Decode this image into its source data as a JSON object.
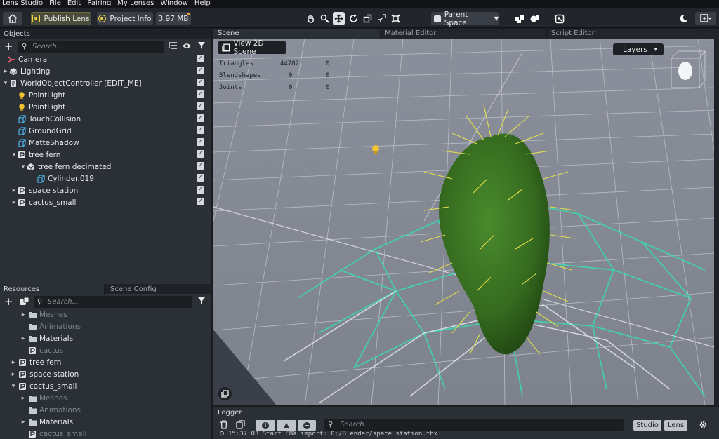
{
  "menubar": {
    "items": [
      "Lens Studio",
      "File",
      "Edit",
      "Pairing",
      "My Lenses",
      "Window",
      "Help"
    ]
  },
  "toolbar": {
    "publish_label": "Publish Lens",
    "project_info_label": "Project Info",
    "size_label": "3.97 MB",
    "space_label": "Parent Space",
    "home_icon": "home-icon",
    "transform_icons": [
      "hand-icon",
      "zoom-icon",
      "move-icon",
      "rotate-icon",
      "scale-icon",
      "rect-icon",
      "pivot-icon"
    ]
  },
  "objects_panel": {
    "title": "Objects",
    "search_placeholder": "Search...",
    "items": [
      {
        "label": "Camera",
        "icon": "camera-icon"
      },
      {
        "label": "Lighting",
        "icon": "lighting-icon"
      },
      {
        "label": "WorldObjectController [EDIT_ME]",
        "icon": "script-icon"
      },
      {
        "label": "PointLight",
        "icon": "bulb-icon"
      },
      {
        "label": "PointLight",
        "icon": "bulb-icon"
      },
      {
        "label": "TouchCollision",
        "icon": "mesh-icon"
      },
      {
        "label": "GroundGrid",
        "icon": "mesh-icon"
      },
      {
        "label": "MatteShadow",
        "icon": "mesh-icon"
      },
      {
        "label": "tree fern",
        "icon": "prefab-icon"
      },
      {
        "label": "tree fern decimated",
        "icon": "object-icon"
      },
      {
        "label": "Cylinder.019",
        "icon": "mesh-icon"
      },
      {
        "label": "space station",
        "icon": "prefab-icon"
      },
      {
        "label": "cactus_small",
        "icon": "prefab-icon"
      }
    ]
  },
  "resources_panel": {
    "tab_resources": "Resources",
    "tab_scene_config": "Scene Config",
    "search_placeholder": "Search...",
    "items": [
      {
        "label": "Meshes",
        "icon": "folder-icon",
        "dim": true
      },
      {
        "label": "Animations",
        "icon": "folder-icon",
        "dim": true
      },
      {
        "label": "Materials",
        "icon": "folder-icon",
        "dim": false
      },
      {
        "label": "cactus",
        "icon": "prefab-icon",
        "dim": true
      },
      {
        "label": "tree fern",
        "icon": "prefab-icon",
        "dim": false
      },
      {
        "label": "space station",
        "icon": "prefab-icon",
        "dim": false
      },
      {
        "label": "cactus_small",
        "icon": "prefab-icon",
        "dim": false
      },
      {
        "label": "Meshes",
        "icon": "folder-icon",
        "dim": true
      },
      {
        "label": "Animations",
        "icon": "folder-icon",
        "dim": true
      },
      {
        "label": "Materials",
        "icon": "folder-icon",
        "dim": false
      },
      {
        "label": "cactus_small",
        "icon": "prefab-icon",
        "dim": true
      }
    ]
  },
  "scene": {
    "tab_scene": "Scene",
    "tab_material_editor": "Material Editor",
    "tab_script_editor": "Script Editor",
    "view_2d_label": "View 2D Scene",
    "layers_label": "Layers",
    "stats": [
      {
        "label": "Triangles",
        "v1": "44782",
        "v2": "0"
      },
      {
        "label": "Blendshapes",
        "v1": "0",
        "v2": "0"
      },
      {
        "label": "Joints",
        "v1": "0",
        "v2": "0"
      }
    ]
  },
  "logger": {
    "title": "Logger",
    "search_placeholder": "Search...",
    "studio_label": "Studio",
    "lens_label": "Lens",
    "log_line": "15:37:03 Start FBX import: D:/Blender/space station.fbx"
  }
}
